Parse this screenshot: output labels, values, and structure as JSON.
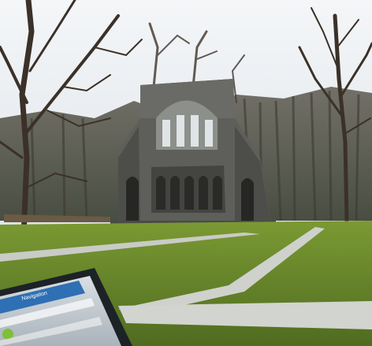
{
  "scene": {
    "subject": "ruined-church-facade",
    "setting": "park-lawn-with-bare-trees"
  },
  "tablet": {
    "title": "Navigation",
    "icon": "app-badge-icon"
  },
  "colors": {
    "sky": "#e9eef2",
    "stone": "#595a58",
    "stone_dark": "#3a3b39",
    "grass": "#6e8c2e",
    "path": "#c9cbc6",
    "tablet_frame": "#1d2227",
    "tablet_header": "#2f6fb3",
    "tablet_badge": "#7fbf3a"
  }
}
